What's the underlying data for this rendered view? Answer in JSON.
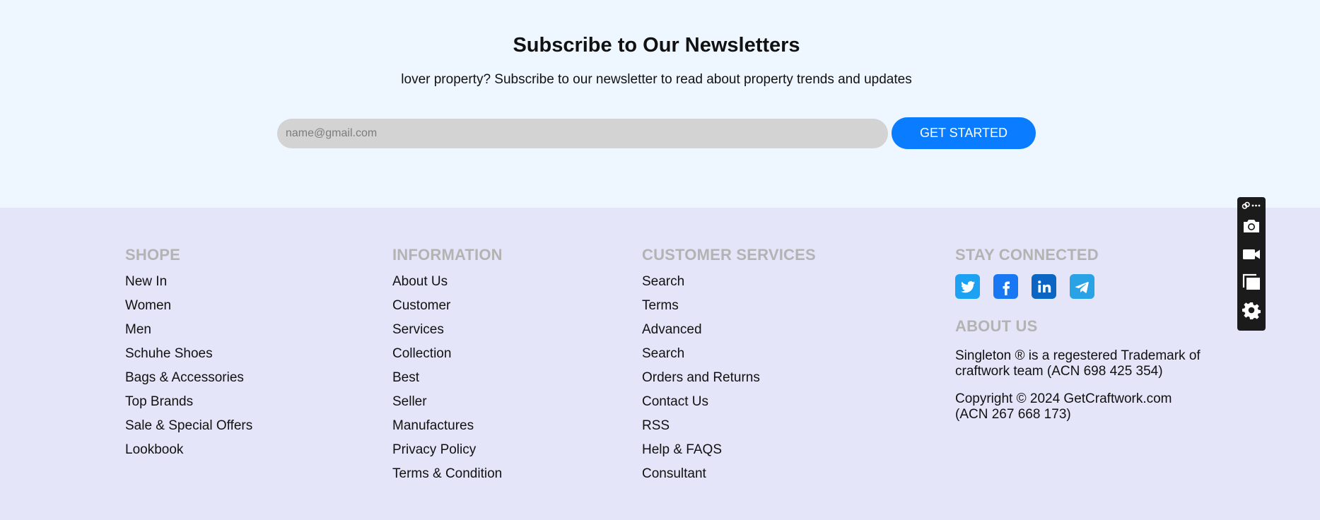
{
  "newsletter": {
    "title": "Subscribe to Our Newsletters",
    "subtitle": "lover property? Subscribe to our newsletter to read about property trends and updates",
    "email_placeholder": "name@gmail.com",
    "email_value": "",
    "button_label": "GET STARTED"
  },
  "footer": {
    "shope": {
      "heading": "SHOPE",
      "items": [
        "New In",
        "Women",
        "Men",
        "Schuhe Shoes",
        "Bags & Accessories",
        "Top Brands",
        "Sale & Special Offers",
        "Lookbook"
      ]
    },
    "information": {
      "heading": "INFORMATION",
      "items": [
        "About Us",
        "Customer",
        "Services",
        "Collection",
        "Best",
        "Seller",
        "Manufactures",
        "Privacy Policy",
        "Terms & Condition"
      ]
    },
    "customer_services": {
      "heading": "CUSTOMER SERVICES",
      "items": [
        "Search",
        "Terms",
        "Advanced",
        "Search",
        "Orders and Returns",
        "Contact Us",
        "RSS",
        "Help & FAQS",
        "Consultant"
      ]
    },
    "stay_connected": {
      "heading": "STAY CONNECTED",
      "icons": [
        "twitter-icon",
        "facebook-icon",
        "linkedin-icon",
        "telegram-icon"
      ]
    },
    "about": {
      "heading": "ABOUT US",
      "trademark": "Singleton ® is a regestered Trademark of craftwork team (ACN 698 425 354)",
      "copyright": "Copyright © 2024 GetCraftwork.com (ACN 267 668 173)"
    }
  },
  "toolbar": {
    "icons": [
      "link-icon",
      "more-icon",
      "camera-icon",
      "video-icon",
      "copy-icon",
      "gear-icon"
    ]
  },
  "colors": {
    "newsletter_bg": "#eef6ff",
    "footer_bg": "#e4e5f8",
    "accent": "#0a7cff",
    "heading_gray": "#b3b3b3"
  }
}
